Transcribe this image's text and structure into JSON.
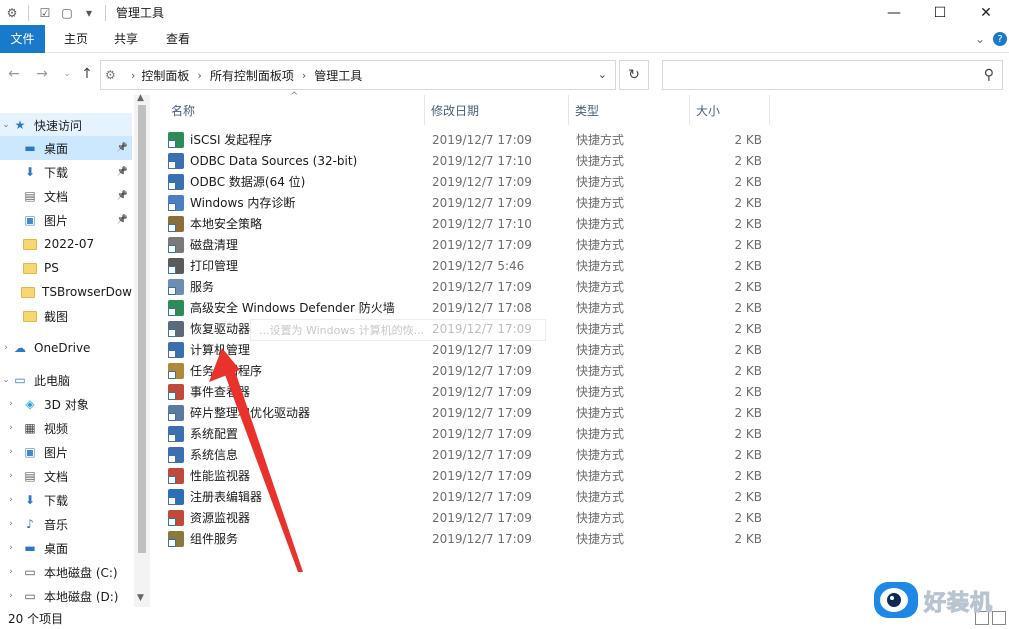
{
  "window": {
    "title": "管理工具",
    "controls": {
      "minimize": "—",
      "maximize": "☐",
      "close": "✕"
    }
  },
  "ribbon": {
    "tabs": [
      {
        "label": "文件",
        "active": true
      },
      {
        "label": "主页"
      },
      {
        "label": "共享"
      },
      {
        "label": "查看"
      }
    ]
  },
  "address": {
    "crumbs": [
      "控制面板",
      "所有控制面板项",
      "管理工具"
    ],
    "search_placeholder": ""
  },
  "nav": {
    "quick_access": "快速访问",
    "quick_items": [
      {
        "label": "桌面",
        "icon": "desktop-icon",
        "pinned": true,
        "selected": true
      },
      {
        "label": "下载",
        "icon": "download-icon",
        "pinned": true
      },
      {
        "label": "文档",
        "icon": "document-icon",
        "pinned": true
      },
      {
        "label": "图片",
        "icon": "picture-icon",
        "pinned": true
      },
      {
        "label": "2022-07",
        "icon": "folder-icon"
      },
      {
        "label": "PS",
        "icon": "folder-icon"
      },
      {
        "label": "TSBrowserDow",
        "icon": "folder-icon"
      },
      {
        "label": "截图",
        "icon": "folder-icon"
      }
    ],
    "onedrive": "OneDrive",
    "this_pc": "此电脑",
    "pc_items": [
      {
        "label": "3D 对象",
        "icon": "3d-objects-icon"
      },
      {
        "label": "视频",
        "icon": "video-icon"
      },
      {
        "label": "图片",
        "icon": "picture-icon"
      },
      {
        "label": "文档",
        "icon": "document-icon"
      },
      {
        "label": "下载",
        "icon": "download-icon"
      },
      {
        "label": "音乐",
        "icon": "music-icon"
      },
      {
        "label": "桌面",
        "icon": "desktop-icon"
      },
      {
        "label": "本地磁盘 (C:)",
        "icon": "drive-icon"
      },
      {
        "label": "本地磁盘 (D:)",
        "icon": "drive-icon"
      }
    ]
  },
  "columns": {
    "name": "名称",
    "date": "修改日期",
    "type": "类型",
    "size": "大小"
  },
  "files": [
    {
      "name": "iSCSI 发起程序",
      "date": "2019/12/7 17:09",
      "type": "快捷方式",
      "size": "2 KB",
      "color": "#2e8b57"
    },
    {
      "name": "ODBC Data Sources (32-bit)",
      "date": "2019/12/7 17:10",
      "type": "快捷方式",
      "size": "2 KB",
      "color": "#3a6fb0"
    },
    {
      "name": "ODBC 数据源(64 位)",
      "date": "2019/12/7 17:09",
      "type": "快捷方式",
      "size": "2 KB",
      "color": "#3a6fb0"
    },
    {
      "name": "Windows 内存诊断",
      "date": "2019/12/7 17:09",
      "type": "快捷方式",
      "size": "2 KB",
      "color": "#4a7fc0"
    },
    {
      "name": "本地安全策略",
      "date": "2019/12/7 17:10",
      "type": "快捷方式",
      "size": "2 KB",
      "color": "#8a6d3b"
    },
    {
      "name": "磁盘清理",
      "date": "2019/12/7 17:09",
      "type": "快捷方式",
      "size": "2 KB",
      "color": "#7a7a7a"
    },
    {
      "name": "打印管理",
      "date": "2019/12/7 5:46",
      "type": "快捷方式",
      "size": "2 KB",
      "color": "#5a5a5a"
    },
    {
      "name": "服务",
      "date": "2019/12/7 17:09",
      "type": "快捷方式",
      "size": "2 KB",
      "color": "#6c8fb0"
    },
    {
      "name": "高级安全 Windows Defender 防火墙",
      "date": "2019/12/7 17:08",
      "type": "快捷方式",
      "size": "2 KB",
      "color": "#2e8b57"
    },
    {
      "name": "恢复驱动器",
      "date": "2019/12/7 17:09",
      "type": "快捷方式",
      "size": "2 KB",
      "color": "#5a6a7a"
    },
    {
      "name": "计算机管理",
      "date": "2019/12/7 17:09",
      "type": "快捷方式",
      "size": "2 KB",
      "color": "#3a6fb0"
    },
    {
      "name": "任务计划程序",
      "date": "2019/12/7 17:09",
      "type": "快捷方式",
      "size": "2 KB",
      "color": "#b0893a"
    },
    {
      "name": "事件查看器",
      "date": "2019/12/7 17:09",
      "type": "快捷方式",
      "size": "2 KB",
      "color": "#c04a3a"
    },
    {
      "name": "碎片整理和优化驱动器",
      "date": "2019/12/7 17:09",
      "type": "快捷方式",
      "size": "2 KB",
      "color": "#5a7aa0"
    },
    {
      "name": "系统配置",
      "date": "2019/12/7 17:09",
      "type": "快捷方式",
      "size": "2 KB",
      "color": "#3a6fb0"
    },
    {
      "name": "系统信息",
      "date": "2019/12/7 17:09",
      "type": "快捷方式",
      "size": "2 KB",
      "color": "#3a6fb0"
    },
    {
      "name": "性能监视器",
      "date": "2019/12/7 17:09",
      "type": "快捷方式",
      "size": "2 KB",
      "color": "#c04a3a"
    },
    {
      "name": "注册表编辑器",
      "date": "2019/12/7 17:09",
      "type": "快捷方式",
      "size": "2 KB",
      "color": "#2a6fb8"
    },
    {
      "name": "资源监视器",
      "date": "2019/12/7 17:09",
      "type": "快捷方式",
      "size": "2 KB",
      "color": "#c04a3a"
    },
    {
      "name": "组件服务",
      "date": "2019/12/7 17:09",
      "type": "快捷方式",
      "size": "2 KB",
      "color": "#8a7a3a"
    }
  ],
  "tooltip": "...设置为 Windows 计算机的恢...",
  "status": {
    "count": "20 个项目"
  },
  "watermark": {
    "text": "好装机"
  },
  "colors": {
    "accent": "#1979ca",
    "selection": "#cce8ff",
    "arrow": "#e8322b"
  }
}
